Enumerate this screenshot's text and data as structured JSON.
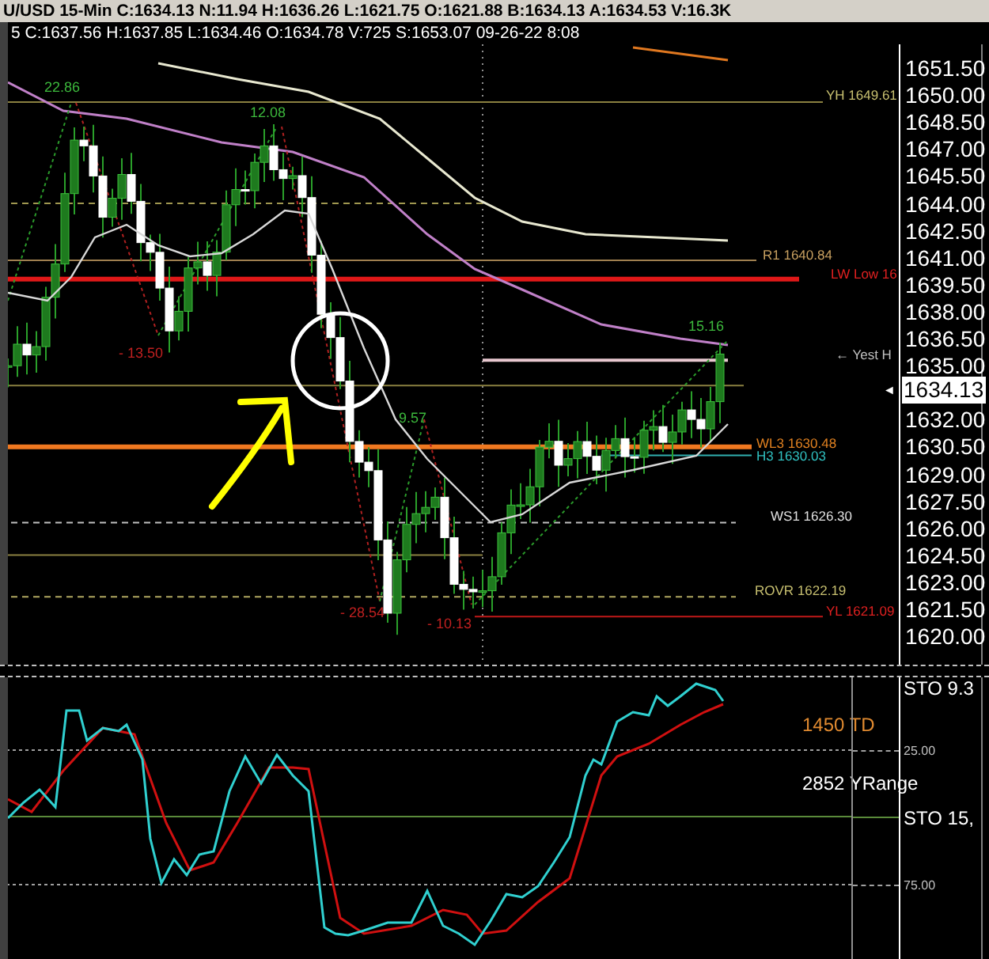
{
  "header": {
    "quote_line": "U/USD  15-Min  C:1634.13  N:11.94  H:1636.26  L:1621.75  O:1621.88  B:1634.13  A:1634.53  V:16.3K",
    "bar_line": "5  C:1637.56  H:1637.85  L:1634.46  O:1634.78  V:725  S:1653.07  09-26-22  8:08"
  },
  "price_chart": {
    "axis_ticks": [
      "1651.50",
      "1650.00",
      "1648.50",
      "1647.00",
      "1645.50",
      "1644.00",
      "1642.50",
      "1641.00",
      "1639.50",
      "1638.00",
      "1636.50",
      "1635.00",
      "1632.00",
      "1630.50",
      "1629.00",
      "1627.50",
      "1626.00",
      "1624.50",
      "1623.00",
      "1621.50",
      "1620.00"
    ],
    "last_price": "1634.13",
    "last_price_arrow": "◄",
    "swing_labels": [
      {
        "text": "22.86",
        "kind": "up"
      },
      {
        "text": "12.08",
        "kind": "up"
      },
      {
        "text": "- 13.50",
        "kind": "down"
      },
      {
        "text": "9.57",
        "kind": "up"
      },
      {
        "text": "- 28.54",
        "kind": "down"
      },
      {
        "text": "- 10.13",
        "kind": "down"
      },
      {
        "text": "15.16",
        "kind": "up"
      }
    ],
    "level_labels": [
      {
        "text": "YH 1649.61",
        "color": "#c8c070"
      },
      {
        "text": "R1 1640.84",
        "color": "#c8a060"
      },
      {
        "text": "LW Low 16",
        "color": "#e02020"
      },
      {
        "text": "← Yest H",
        "color": "#c0c0c0"
      },
      {
        "text": "WL3 1630.48",
        "color": "#e08020"
      },
      {
        "text": "H3 1630.03",
        "color": "#30c0c0"
      },
      {
        "text": "WS1 1626.30",
        "color": "#e0e0e0"
      },
      {
        "text": "ROVR 1622.19",
        "color": "#c8c070"
      },
      {
        "text": "YL 1621.09",
        "color": "#e02020"
      }
    ]
  },
  "oscillator": {
    "title": "STO  9.3",
    "ticks": [
      "25.00",
      "75.00"
    ],
    "notes": [
      {
        "text": "1450 TD",
        "color": "#e08a30"
      },
      {
        "text": "2852 YRange",
        "color": "#ffffff"
      }
    ],
    "second_title": "STO  15,"
  }
}
